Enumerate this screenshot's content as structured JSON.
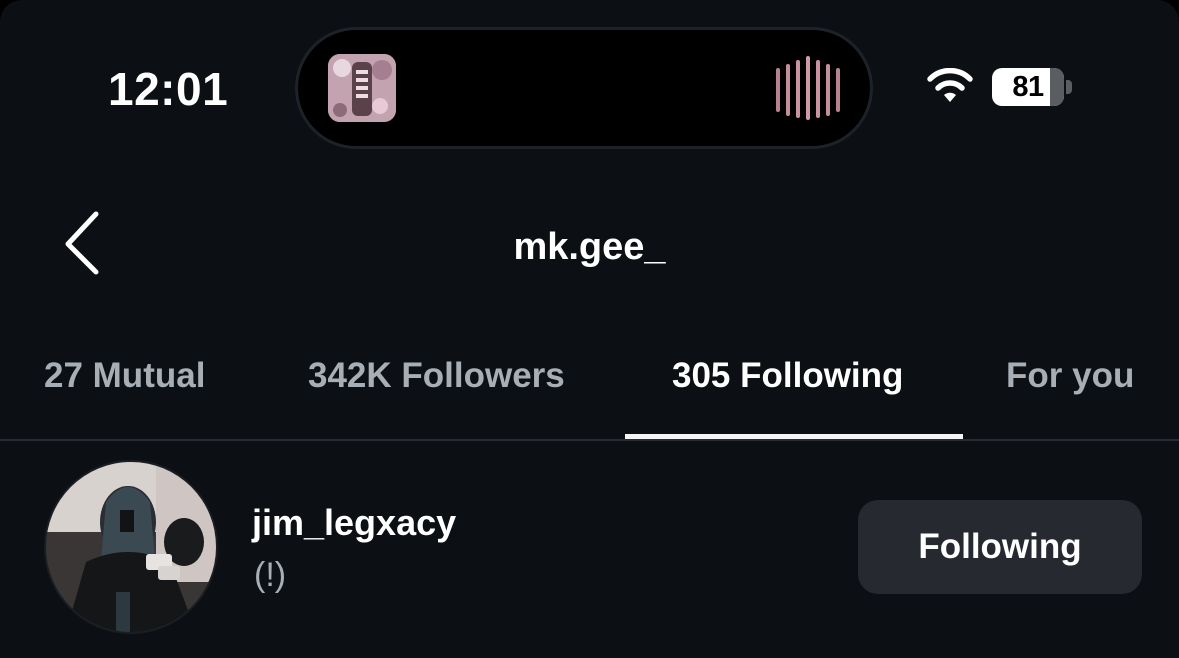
{
  "status_bar": {
    "time": "12:01",
    "battery_level": "81",
    "battery_fraction": 0.81
  },
  "header": {
    "title": "mk.gee_"
  },
  "tabs": [
    {
      "label": "27 Mutual",
      "active": false
    },
    {
      "label": "342K Followers",
      "active": false
    },
    {
      "label": "305 Following",
      "active": true
    },
    {
      "label": "For you",
      "active": false
    }
  ],
  "list": [
    {
      "username": "jim_legxacy",
      "subtitle": "(!)",
      "button_label": "Following"
    }
  ],
  "colors": {
    "background": "#0c1014",
    "primary_text": "#ffffff",
    "secondary_text": "#a8aeb5",
    "button_background": "#262a30",
    "divider": "#262b31"
  }
}
